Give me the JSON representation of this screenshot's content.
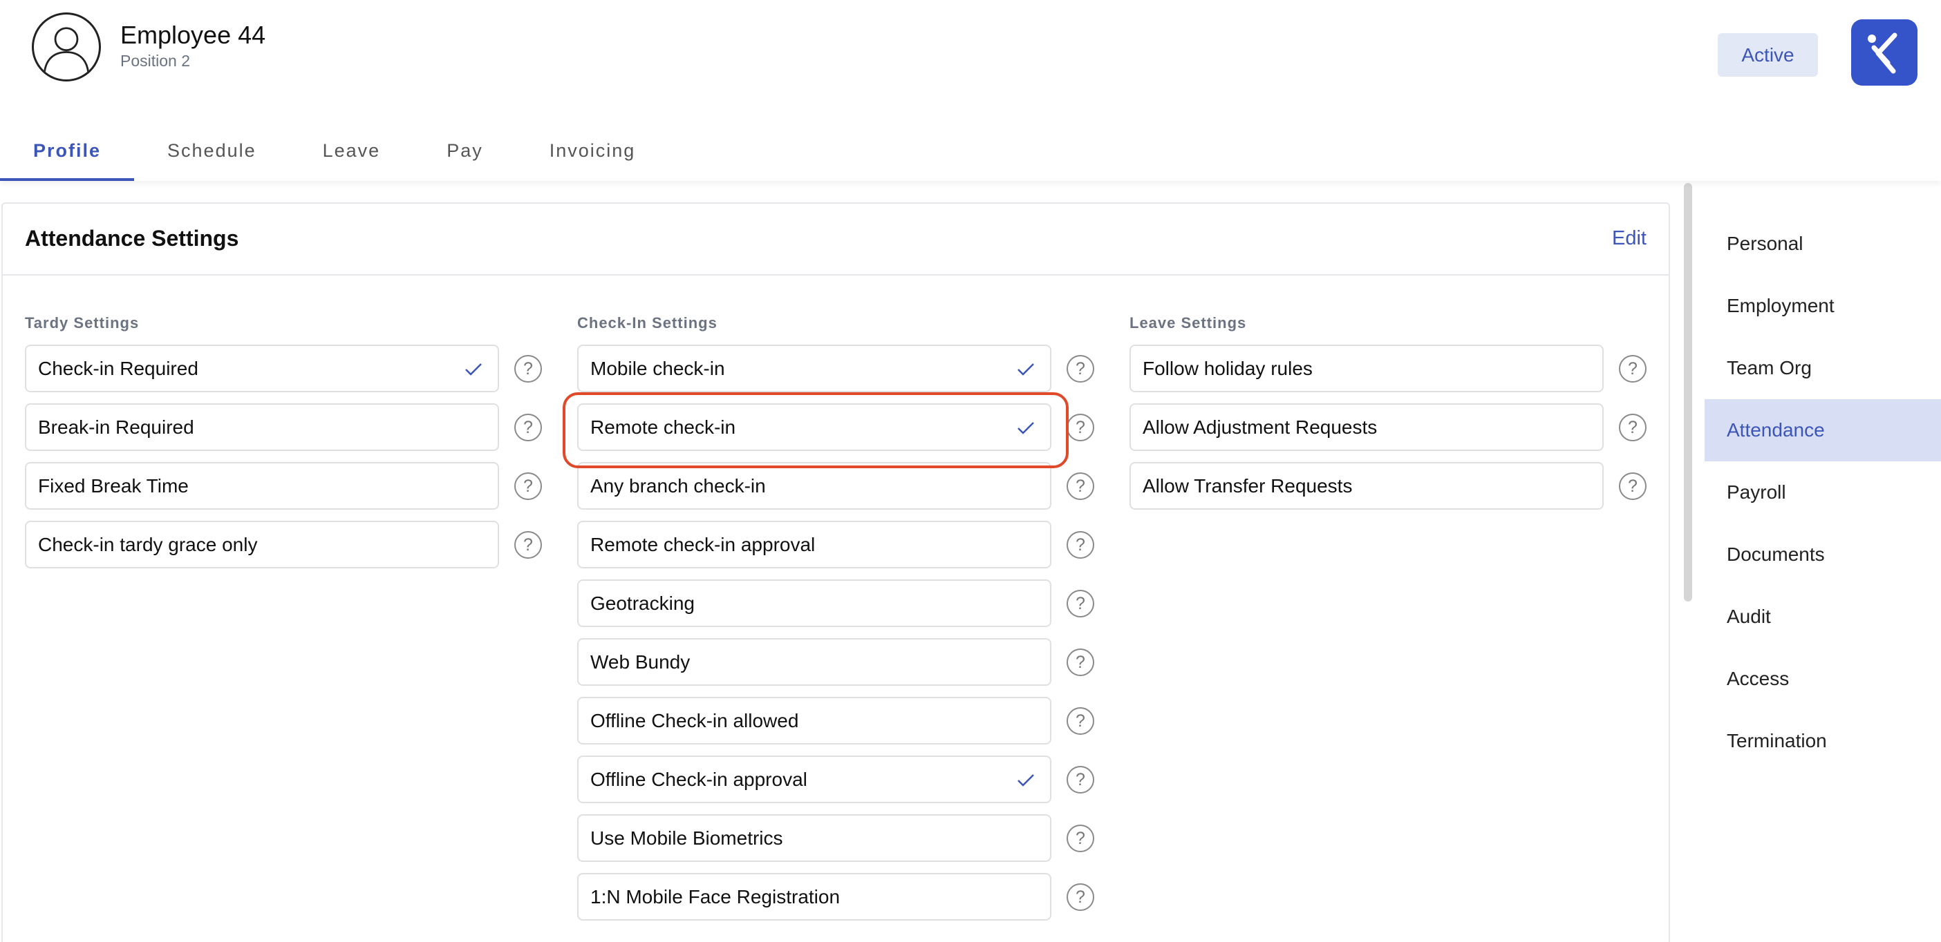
{
  "employee": {
    "name": "Employee 44",
    "position": "Position 2"
  },
  "status": "Active",
  "tabs": [
    {
      "label": "Profile",
      "active": true
    },
    {
      "label": "Schedule"
    },
    {
      "label": "Leave"
    },
    {
      "label": "Pay"
    },
    {
      "label": "Invoicing"
    }
  ],
  "card": {
    "title": "Attendance Settings",
    "edit_label": "Edit"
  },
  "tardy": {
    "label": "Tardy Settings",
    "items": [
      {
        "label": "Check-in Required",
        "checked": true
      },
      {
        "label": "Break-in Required",
        "checked": false
      },
      {
        "label": "Fixed Break Time",
        "checked": false
      },
      {
        "label": "Check-in tardy grace only",
        "checked": false
      }
    ]
  },
  "checkin": {
    "label": "Check-In Settings",
    "items": [
      {
        "label": "Mobile check-in",
        "checked": true
      },
      {
        "label": "Remote check-in",
        "checked": true
      },
      {
        "label": "Any branch check-in",
        "checked": false
      },
      {
        "label": "Remote check-in approval",
        "checked": false
      },
      {
        "label": "Geotracking",
        "checked": false
      },
      {
        "label": "Web Bundy",
        "checked": false
      },
      {
        "label": "Offline Check-in allowed",
        "checked": false
      },
      {
        "label": "Offline Check-in approval",
        "checked": true
      },
      {
        "label": "Use Mobile Biometrics",
        "checked": false
      },
      {
        "label": "1:N Mobile Face Registration",
        "checked": false
      }
    ]
  },
  "leave": {
    "label": "Leave Settings",
    "items": [
      {
        "label": "Follow holiday rules",
        "checked": false
      },
      {
        "label": "Allow Adjustment Requests",
        "checked": false
      },
      {
        "label": "Allow Transfer Requests",
        "checked": false
      }
    ]
  },
  "help_glyph": "?",
  "sidenav": {
    "items": [
      {
        "label": "Personal"
      },
      {
        "label": "Employment"
      },
      {
        "label": "Team Org"
      },
      {
        "label": "Attendance",
        "active": true
      },
      {
        "label": "Payroll"
      },
      {
        "label": "Documents"
      },
      {
        "label": "Audit"
      },
      {
        "label": "Access"
      },
      {
        "label": "Termination"
      }
    ]
  },
  "colors": {
    "accent": "#3c55b8",
    "highlight": "#e04a2a",
    "nav_active_bg": "#d8def3"
  }
}
